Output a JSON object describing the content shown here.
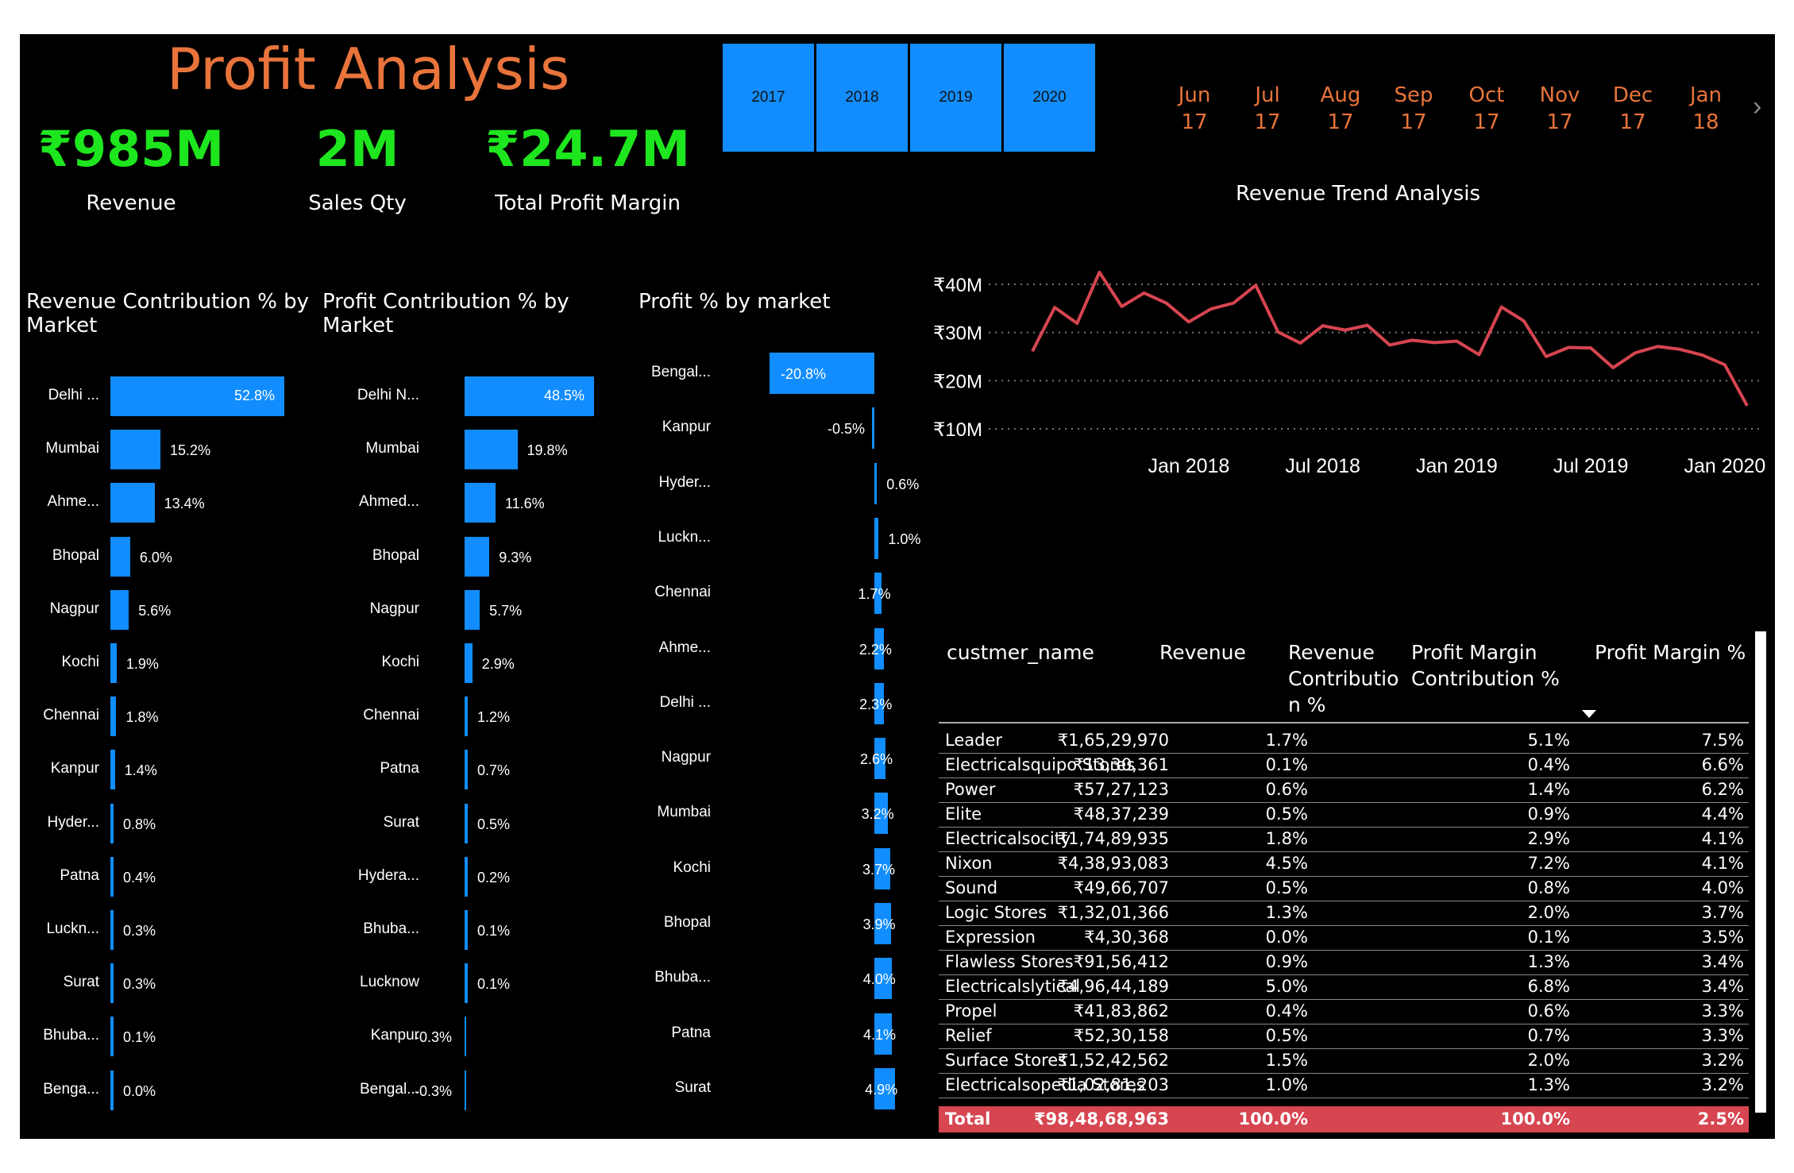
{
  "header": {
    "title": "Profit Analysis"
  },
  "kpis": [
    {
      "value": "₹985M",
      "label": "Revenue"
    },
    {
      "value": "2M",
      "label": "Sales Qty"
    },
    {
      "value": "₹24.7M",
      "label": "Total Profit Margin"
    }
  ],
  "year_slicer": [
    "2017",
    "2018",
    "2019",
    "2020"
  ],
  "month_slicer": [
    {
      "m": "Jun",
      "y": "17"
    },
    {
      "m": "Jul",
      "y": "17"
    },
    {
      "m": "Aug",
      "y": "17"
    },
    {
      "m": "Sep",
      "y": "17"
    },
    {
      "m": "Oct",
      "y": "17"
    },
    {
      "m": "Nov",
      "y": "17"
    },
    {
      "m": "Dec",
      "y": "17"
    },
    {
      "m": "Jan",
      "y": "18"
    }
  ],
  "month_next_icon": "chevron-right-icon",
  "colors": {
    "accent": "#118dff",
    "title": "#e8743b",
    "kpi": "#1ee61e",
    "trend_line": "#d64550",
    "total_row": "#d64550"
  },
  "revenue_market": {
    "title_line1": "Revenue Contribution % by",
    "title_line2": "Market",
    "labels": [
      "Delhi ...",
      "Mumbai",
      "Ahme...",
      "Bhopal",
      "Nagpur",
      "Kochi",
      "Chennai",
      "Kanpur",
      "Hyder...",
      "Patna",
      "Luckn...",
      "Surat",
      "Bhuba...",
      "Benga..."
    ],
    "values": [
      52.8,
      15.2,
      13.4,
      6.0,
      5.6,
      1.9,
      1.8,
      1.4,
      0.8,
      0.4,
      0.3,
      0.3,
      0.1,
      0.0
    ],
    "texts": [
      "52.8%",
      "15.2%",
      "13.4%",
      "6.0%",
      "5.6%",
      "1.9%",
      "1.8%",
      "1.4%",
      "0.8%",
      "0.4%",
      "0.3%",
      "0.3%",
      "0.1%",
      "0.0%"
    ]
  },
  "profit_market": {
    "title_line1": "Profit Contribution % by",
    "title_line2": "Market",
    "labels": [
      "Delhi N...",
      "Mumbai",
      "Ahmed...",
      "Bhopal",
      "Nagpur",
      "Kochi",
      "Chennai",
      "Patna",
      "Surat",
      "Hydera...",
      "Bhuba...",
      "Lucknow",
      "Kanpur",
      "Bengal..."
    ],
    "values": [
      48.5,
      19.8,
      11.6,
      9.3,
      5.7,
      2.9,
      1.2,
      0.7,
      0.5,
      0.2,
      0.1,
      0.1,
      -0.3,
      -0.3
    ],
    "texts": [
      "48.5%",
      "19.8%",
      "11.6%",
      "9.3%",
      "5.7%",
      "2.9%",
      "1.2%",
      "0.7%",
      "0.5%",
      "0.2%",
      "0.1%",
      "0.1%",
      "-0.3%",
      "-0.3%"
    ]
  },
  "profit_pct": {
    "title": "Profit % by market",
    "labels": [
      "Bengal...",
      "Kanpur",
      "Hyder...",
      "Luckn...",
      "Chennai",
      "Ahme...",
      "Delhi ...",
      "Nagpur",
      "Mumbai",
      "Kochi",
      "Bhopal",
      "Bhuba...",
      "Patna",
      "Surat"
    ],
    "values": [
      -20.8,
      -0.5,
      0.6,
      1.0,
      1.7,
      2.2,
      2.3,
      2.6,
      3.2,
      3.7,
      3.9,
      4.0,
      4.1,
      4.9
    ],
    "texts": [
      "-20.8%",
      "-0.5%",
      "0.6%",
      "1.0%",
      "1.7%",
      "2.2%",
      "2.3%",
      "2.6%",
      "3.2%",
      "3.7%",
      "3.9%",
      "4.0%",
      "4.1%",
      "4.9%"
    ]
  },
  "chart_data": {
    "type": "line",
    "title": "Revenue Trend Analysis",
    "x_tick_labels": [
      "Jan 2018",
      "Jul 2018",
      "Jan 2019",
      "Jul 2019",
      "Jan 2020"
    ],
    "y_tick_labels": [
      "₹40M",
      "₹30M",
      "₹20M",
      "₹10M"
    ],
    "y_ticks": [
      40,
      30,
      20,
      10
    ],
    "ylim": [
      10,
      42
    ],
    "grid": true,
    "x": [
      "2017-06",
      "2017-07",
      "2017-08",
      "2017-09",
      "2017-10",
      "2017-11",
      "2017-12",
      "2018-01",
      "2018-02",
      "2018-03",
      "2018-04",
      "2018-05",
      "2018-06",
      "2018-07",
      "2018-08",
      "2018-09",
      "2018-10",
      "2018-11",
      "2018-12",
      "2019-01",
      "2019-02",
      "2019-03",
      "2019-04",
      "2019-05",
      "2019-06",
      "2019-07",
      "2019-08",
      "2019-09",
      "2019-10",
      "2019-11",
      "2019-12",
      "2020-01",
      "2020-02",
      "2020-03",
      "2020-04",
      "2020-05",
      "2020-06"
    ],
    "values": [
      26.1,
      35.2,
      31.9,
      42.5,
      35.4,
      38.2,
      36.1,
      32.2,
      34.9,
      36.1,
      39.8,
      30.1,
      27.8,
      31.4,
      30.5,
      31.5,
      27.4,
      28.4,
      27.9,
      28.2,
      25.4,
      35.3,
      32.4,
      25.0,
      26.9,
      26.8,
      22.7,
      25.8,
      27.1,
      26.5,
      25.3,
      23.3,
      14.8
    ],
    "series": [
      {
        "name": "Revenue"
      }
    ]
  },
  "table": {
    "headers": [
      "custmer_name",
      "Revenue",
      "Revenue Contributio n %",
      "Profit Margin Contribution %",
      "Profit Margin %"
    ],
    "header_lines": {
      "c2": [
        "Revenue",
        "Contributio",
        "n %"
      ],
      "c3": [
        "Profit Margin",
        "Contribution %"
      ]
    },
    "sort_icon": "sort-down-icon",
    "rows": [
      [
        "Leader",
        "₹1,65,29,970",
        "1.7%",
        "5.1%",
        "7.5%"
      ],
      [
        "Electricalsquipo Stores",
        "₹13,30,361",
        "0.1%",
        "0.4%",
        "6.6%"
      ],
      [
        "Power",
        "₹57,27,123",
        "0.6%",
        "1.4%",
        "6.2%"
      ],
      [
        "Elite",
        "₹48,37,239",
        "0.5%",
        "0.9%",
        "4.4%"
      ],
      [
        "Electricalsocity",
        "₹1,74,89,935",
        "1.8%",
        "2.9%",
        "4.1%"
      ],
      [
        "Nixon",
        "₹4,38,93,083",
        "4.5%",
        "7.2%",
        "4.1%"
      ],
      [
        "Sound",
        "₹49,66,707",
        "0.5%",
        "0.8%",
        "4.0%"
      ],
      [
        "Logic Stores",
        "₹1,32,01,366",
        "1.3%",
        "2.0%",
        "3.7%"
      ],
      [
        "Expression",
        "₹4,30,368",
        "0.0%",
        "0.1%",
        "3.5%"
      ],
      [
        "Flawless Stores",
        "₹91,56,412",
        "0.9%",
        "1.3%",
        "3.4%"
      ],
      [
        "Electricalslytical",
        "₹4,96,44,189",
        "5.0%",
        "6.8%",
        "3.4%"
      ],
      [
        "Propel",
        "₹41,83,862",
        "0.4%",
        "0.6%",
        "3.3%"
      ],
      [
        "Relief",
        "₹52,30,158",
        "0.5%",
        "0.7%",
        "3.3%"
      ],
      [
        "Surface Stores",
        "₹1,52,42,562",
        "1.5%",
        "2.0%",
        "3.2%"
      ],
      [
        "Electricalsopedia Stores",
        "₹1,02,81,203",
        "1.0%",
        "1.3%",
        "3.2%"
      ]
    ],
    "total": [
      "Total",
      "₹98,48,68,963",
      "100.0%",
      "100.0%",
      "2.5%"
    ]
  }
}
